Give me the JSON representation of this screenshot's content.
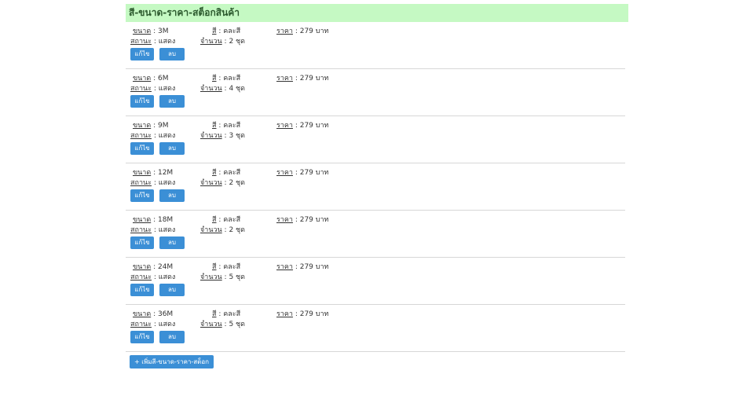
{
  "panel": {
    "title": "สี-ขนาด-ราคา-สต็อกสินค้า",
    "labels": {
      "size": "ขนาด",
      "status": "สถานะ",
      "color": "สี",
      "quantity": "จำนวน",
      "price": "ราคา",
      "sep": " : "
    },
    "buttons": {
      "edit": "แก้ไข",
      "delete": "ลบ"
    },
    "items": [
      {
        "size": "3M",
        "status": "แสดง",
        "color": "คละสี",
        "quantity": "2 ชุด",
        "price": "279 บาท"
      },
      {
        "size": "6M",
        "status": "แสดง",
        "color": "คละสี",
        "quantity": "4 ชุด",
        "price": "279 บาท"
      },
      {
        "size": "9M",
        "status": "แสดง",
        "color": "คละสี",
        "quantity": "3 ชุด",
        "price": "279 บาท"
      },
      {
        "size": "12M",
        "status": "แสดง",
        "color": "คละสี",
        "quantity": "2 ชุด",
        "price": "279 บาท"
      },
      {
        "size": "18M",
        "status": "แสดง",
        "color": "คละสี",
        "quantity": "2 ชุด",
        "price": "279 บาท"
      },
      {
        "size": "24M",
        "status": "แสดง",
        "color": "คละสี",
        "quantity": "5 ชุด",
        "price": "279 บาท"
      },
      {
        "size": "36M",
        "status": "แสดง",
        "color": "คละสี",
        "quantity": "5 ชุด",
        "price": "279 บาท"
      }
    ],
    "add_button": "+ เพิ่มสี-ขนาด-ราคา-สต็อก"
  },
  "colors": {
    "header_bg": "#c5f9c3",
    "button_bg": "#3b8fd6"
  }
}
